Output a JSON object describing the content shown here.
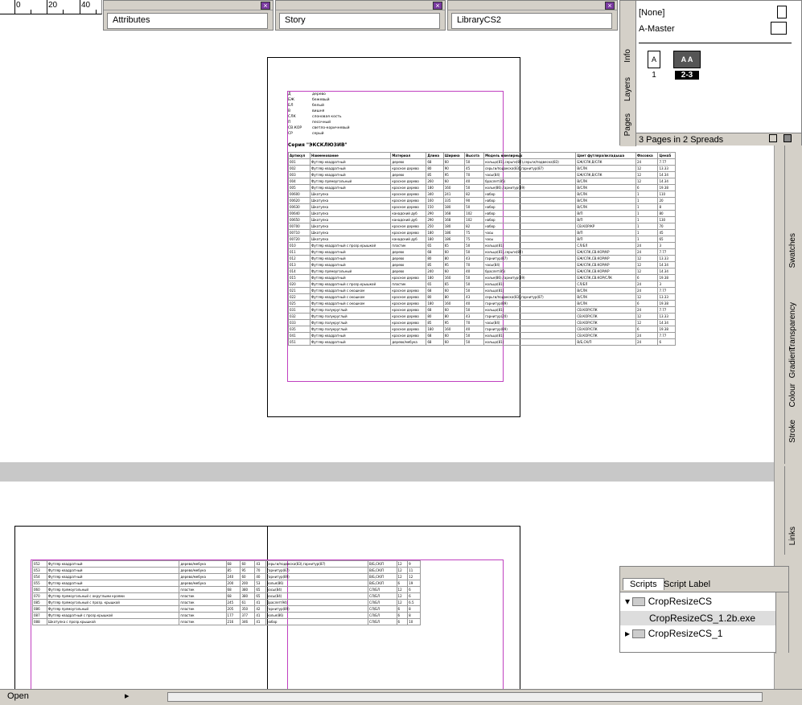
{
  "ruler": {
    "labels": [
      "0",
      "20",
      "40"
    ]
  },
  "panels": {
    "attributes": "Attributes",
    "story": "Story",
    "library": "LibraryCS2"
  },
  "pages_panel": {
    "none": "[None]",
    "master": "A-Master",
    "page1_letter": "A",
    "page1_num": "1",
    "spread_letters": "A A",
    "spread_num": "2-3",
    "status": "3 Pages in 2 Spreads",
    "tabs": [
      "Pages",
      "Layers",
      "Info"
    ]
  },
  "right_tabs": [
    "Swatches",
    "Stroke",
    "Colour",
    "Gradient",
    "Transparency",
    "Links"
  ],
  "scripts_panel": {
    "tab1": "Scripts",
    "tab2": "Script Label",
    "items": [
      {
        "label": "CropResizeCS"
      },
      {
        "label": "CropResizeCS_1.2b.exe"
      },
      {
        "label": "CropResizeCS_1"
      }
    ]
  },
  "bottom": {
    "open_label": "Open"
  },
  "doc": {
    "legend": [
      [
        "Д",
        "дерево"
      ],
      [
        "БЖ",
        "бежевый"
      ],
      [
        "БЛ",
        "белый"
      ],
      [
        "В",
        "вишня"
      ],
      [
        "СЛК",
        "слоновая кость"
      ],
      [
        "П",
        "песочный"
      ],
      [
        "СВ.КОР",
        "светло-коричневый"
      ],
      [
        "СР",
        "серый"
      ]
    ],
    "series_title": "Серия \"ЭКСКЛЮЗИВ\"",
    "headers": [
      "Артикул",
      "Наименование",
      "Материал",
      "Длина",
      "Ширина",
      "Высота",
      "Модель ювелирных",
      "Цвет футляра/вкладыша",
      "Фасовка",
      "ЦенаS"
    ],
    "rows": [
      [
        "001",
        "Футляр квадратный",
        "дерево",
        "68",
        "60",
        "50",
        "кольцо(81),серьги(82),серьги/подвеска(83)",
        "БЖ/СЛК,В/СЛК",
        "24",
        "7.77"
      ],
      [
        "002",
        "Футляр квадратный",
        "красное дерево",
        "80",
        "90",
        "45",
        "серьги/подвеска(83),гарнитур(87)",
        "В/СЛК",
        "12",
        "13.33"
      ],
      [
        "003",
        "Футляр квадратный",
        "дерево",
        "85",
        "95",
        "70",
        "часы(84)",
        "БЖ/СЛК,В/СЛК",
        "12",
        "14.34"
      ],
      [
        "004",
        "Футляр прямоугольный",
        "красное дерево",
        "260",
        "60",
        "40",
        "браслет(85)",
        "В/СЛК",
        "12",
        "14.34"
      ],
      [
        "005",
        "Футляр квадратный",
        "красное дерево",
        "180",
        "160",
        "50",
        "колье(86),гарнитур(89)",
        "В/СЛК",
        "6",
        "19.38"
      ],
      [
        "00600",
        "Шкатулка",
        "красное дерево",
        "340",
        "241",
        "82",
        "набор",
        "В/СЛК",
        "1",
        "110"
      ],
      [
        "00620",
        "Шкатулка",
        "красное дерево",
        "160",
        "335",
        "90",
        "набор",
        "В/СЛК",
        "1",
        "20"
      ],
      [
        "00630",
        "Шкатулка",
        "красное дерево",
        "150",
        "180",
        "50",
        "набор",
        "В/СЛК",
        "1",
        "8"
      ],
      [
        "00640",
        "Шкатулка",
        "канадский дуб",
        "290",
        "168",
        "102",
        "набор",
        "В/П",
        "1",
        "80"
      ],
      [
        "00650",
        "Шкатулка",
        "канадский дуб",
        "290",
        "168",
        "102",
        "набор",
        "В/П",
        "1",
        "130"
      ],
      [
        "00700",
        "Шкатулка",
        "красное дерево",
        "250",
        "180",
        "82",
        "набор",
        "СВ.КОР/КР",
        "1",
        "70"
      ],
      [
        "00710",
        "Шкатулка",
        "красное дерево",
        "180",
        "186",
        "75",
        "часы",
        "В/П",
        "1",
        "45"
      ],
      [
        "00720",
        "Шкатулка",
        "канадский дуб",
        "180",
        "186",
        "75",
        "часы",
        "В/П",
        "1",
        "65"
      ],
      [
        "010",
        "Футляр квадратный с прозр.крышкой",
        "пластик",
        "65",
        "65",
        "50",
        "кольцо(81)",
        "СЛ/БЛ",
        "24",
        "3"
      ],
      [
        "011",
        "Футляр квадратный",
        "дерево",
        "68",
        "60",
        "50",
        "кольцо(81),серьги(82)",
        "БЖ/СЛК,СВ.КОР/КР",
        "24",
        "7.77"
      ],
      [
        "012",
        "Футляр квадратный",
        "дерево",
        "80",
        "80",
        "43",
        "гарнитур(87)",
        "БЖ/СЛК,СВ.КОР/КР",
        "12",
        "13.33"
      ],
      [
        "013",
        "Футляр квадратный",
        "дерево",
        "85",
        "95",
        "70",
        "часы(84)",
        "БЖ/СЛК,СВ.КОР/КР",
        "12",
        "14.34"
      ],
      [
        "014",
        "Футляр прямоугольный",
        "дерево",
        "240",
        "60",
        "40",
        "браслет(85)",
        "БЖ/СЛК,СВ.КОР/КР",
        "12",
        "14.34"
      ],
      [
        "015",
        "Футляр квадратный",
        "красное дерево",
        "180",
        "160",
        "50",
        "колье(86),гарнитур(89)",
        "БЖ/СЛК,СВ.КОР/СЛК",
        "6",
        "19.38"
      ],
      [
        "020",
        "Футляр квадратный с прозр.крышкой",
        "пластик",
        "65",
        "65",
        "50",
        "кольцо(81)",
        "СЛ/БЛ",
        "24",
        "3"
      ],
      [
        "021",
        "Футляр квадратный с окошком",
        "красное дерево",
        "68",
        "60",
        "50",
        "кольцо(81)",
        "В/СЛК",
        "24",
        "7.77"
      ],
      [
        "022",
        "Футляр квадратный с окошком",
        "красное дерево",
        "80",
        "80",
        "43",
        "серьги/подвеска(83),гарнитур(87)",
        "В/СЛК",
        "12",
        "13.33"
      ],
      [
        "025",
        "Футляр квадратный с окошком",
        "красное дерево",
        "180",
        "160",
        "40",
        "гарнитур(89)",
        "В/СЛК",
        "6",
        "19.38"
      ],
      [
        "031",
        "Футляр полукруглый",
        "красное дерево",
        "68",
        "60",
        "50",
        "кольцо(81)",
        "СВ.КОР/СЛК",
        "24",
        "7.77"
      ],
      [
        "032",
        "Футляр полукруглый",
        "красное дерево",
        "80",
        "80",
        "43",
        "гарнитур(20)",
        "СВ.КОР/СЛК",
        "12",
        "13.33"
      ],
      [
        "033",
        "Футляр полукруглый",
        "красное дерево",
        "85",
        "95",
        "70",
        "часы(84)",
        "СВ.КОР/СЛК",
        "12",
        "14.34"
      ],
      [
        "035",
        "Футляр полукруглый",
        "красное дерево",
        "180",
        "160",
        "40",
        "гарнитур(89)",
        "СВ.КОР/СЛК",
        "6",
        "19.38"
      ],
      [
        "041",
        "Футляр квадратный",
        "красное дерево",
        "68",
        "60",
        "50",
        "кольцо(81)",
        "СВ.КОР/СЛК",
        "24",
        "7.77"
      ],
      [
        "051",
        "Футляр квадратный",
        "дерево/мебука",
        "68",
        "60",
        "50",
        "кольцо(81)",
        "В/Б,СК/П",
        "24",
        "6"
      ]
    ],
    "rows2": [
      [
        "052",
        "Футляр квадратный",
        "дерево/мебука",
        "68",
        "60",
        "43",
        "серьги/подвеска(83),гарнитур(87)",
        "В/Б,СК/П",
        "12",
        "9"
      ],
      [
        "053",
        "Футляр квадратный",
        "дерево/мебука",
        "85",
        "95",
        "70",
        "гарнитур(87)",
        "В/Б,СК/П",
        "12",
        "11"
      ],
      [
        "054",
        "Футляр квадратный",
        "дерево/мебука",
        "240",
        "60",
        "40",
        "гарнитур(89)",
        "В/Б,СК/П",
        "12",
        "12"
      ],
      [
        "055",
        "Футляр квадратный",
        "дерево/мебука",
        "200",
        "200",
        "53",
        "колье(86)",
        "В/Б,СК/П",
        "6",
        "19"
      ],
      [
        "060",
        "Футляр прямоугольный",
        "пластик",
        "68",
        "380",
        "65",
        "часы(84)",
        "СЛ/БЛ",
        "12",
        "6"
      ],
      [
        "070",
        "Футляр прямоугольный с округлыми краями",
        "пластик",
        "68",
        "380",
        "65",
        "часы(84)",
        "СЛ/БЛ",
        "12",
        "6"
      ],
      [
        "085",
        "Футляр прямоугольный с прозр. крышкой",
        "пластик",
        "245",
        "61",
        "41",
        "браслет(94)",
        "СЛ/БЛ",
        "12",
        "6.5"
      ],
      [
        "086",
        "Футляр прямоугольный",
        "пластик",
        "205",
        "350",
        "42",
        "гарнитур(89)",
        "СЛ/БЛ",
        "6",
        "8"
      ],
      [
        "087",
        "Футляр квадратный с прозр.крышкой",
        "пластик",
        "177",
        "377",
        "41",
        "колье(86)",
        "СЛ/БЛ",
        "6",
        "8"
      ],
      [
        "088",
        "Шкатулка с прозр.крышкой",
        "пластик",
        "216",
        "346",
        "41",
        "набор",
        "СЛ/БЛ",
        "6",
        "10"
      ]
    ]
  }
}
